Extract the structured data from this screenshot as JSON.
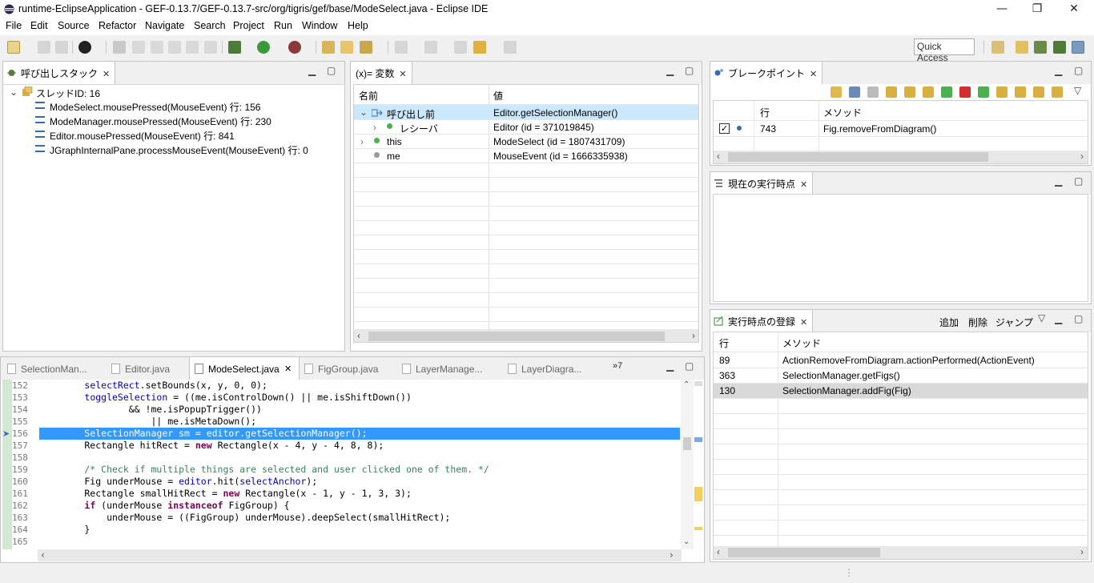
{
  "window": {
    "title": "runtime-EclipseApplication - GEF-0.13.7/GEF-0.13.7-src/org/tigris/gef/base/ModeSelect.java - Eclipse IDE",
    "minimize": "—",
    "restore": "❐",
    "close": "✕"
  },
  "menu": [
    "File",
    "Edit",
    "Source",
    "Refactor",
    "Navigate",
    "Search",
    "Project",
    "Run",
    "Window",
    "Help"
  ],
  "toolbar": {
    "quick_access": "Quick Access"
  },
  "callstack": {
    "title": "呼び出しスタック",
    "thread": "スレッドID: 16",
    "frames": [
      "ModeSelect.mousePressed(MouseEvent) 行: 156",
      "ModeManager.mousePressed(MouseEvent) 行: 230",
      "Editor.mousePressed(MouseEvent) 行: 841",
      "JGraphInternalPane.processMouseEvent(MouseEvent) 行: 0"
    ]
  },
  "variables": {
    "title": "(x)= 変数",
    "col_name": "名前",
    "col_value": "値",
    "rows": [
      {
        "name": "呼び出し前",
        "value": "Editor.getSelectionManager()"
      },
      {
        "name": "レシーバ",
        "value": "Editor  (id = 371019845)"
      },
      {
        "name": "this",
        "value": "ModeSelect  (id = 1807431709)"
      },
      {
        "name": "me",
        "value": "MouseEvent  (id = 1666335938)"
      }
    ]
  },
  "breakpoints": {
    "title": "ブレークポイント",
    "col_line": "行",
    "col_method": "メソッド",
    "rows": [
      {
        "line": "743",
        "method": "Fig.removeFromDiagram()"
      }
    ]
  },
  "current": {
    "title": "現在の実行時点"
  },
  "registry": {
    "title": "実行時点の登録",
    "add": "追加",
    "remove": "削除",
    "jump": "ジャンプ",
    "col_line": "行",
    "col_method": "メソッド",
    "rows": [
      {
        "line": "89",
        "method": "ActionRemoveFromDiagram.actionPerformed(ActionEvent)"
      },
      {
        "line": "363",
        "method": "SelectionManager.getFigs()"
      },
      {
        "line": "130",
        "method": "SelectionManager.addFig(Fig)"
      }
    ]
  },
  "editor": {
    "tabs": [
      "SelectionMan...",
      "Editor.java",
      "ModeSelect.java",
      "FigGroup.java",
      "LayerManage...",
      "LayerDiagra..."
    ],
    "overflow": "»7",
    "lines": [
      {
        "n": "152",
        "code": "        selectRect.setBounds(x, y, 0, 0);"
      },
      {
        "n": "153",
        "code": "        toggleSelection = ((me.isControlDown() || me.isShiftDown())"
      },
      {
        "n": "154",
        "code": "                && !me.isPopupTrigger())"
      },
      {
        "n": "155",
        "code": "                    || me.isMetaDown();"
      },
      {
        "n": "156",
        "code": "        SelectionManager sm = editor.getSelectionManager();"
      },
      {
        "n": "157",
        "code": "        Rectangle hitRect = new Rectangle(x - 4, y - 4, 8, 8);"
      },
      {
        "n": "158",
        "code": ""
      },
      {
        "n": "159",
        "code": "        /* Check if multiple things are selected and user clicked one of them. */"
      },
      {
        "n": "160",
        "code": "        Fig underMouse = editor.hit(selectAnchor);"
      },
      {
        "n": "161",
        "code": "        Rectangle smallHitRect = new Rectangle(x - 1, y - 1, 3, 3);"
      },
      {
        "n": "162",
        "code": "        if (underMouse instanceof FigGroup) {"
      },
      {
        "n": "163",
        "code": "            underMouse = ((FigGroup) underMouse).deepSelect(smallHitRect);"
      },
      {
        "n": "164",
        "code": "        }"
      },
      {
        "n": "165",
        "code": ""
      }
    ]
  }
}
